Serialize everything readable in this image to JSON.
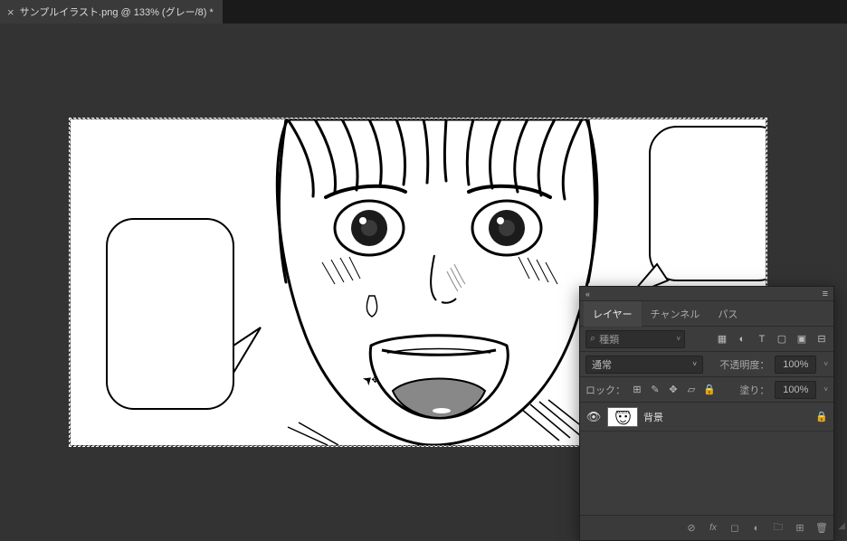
{
  "tab": {
    "close_glyph": "×",
    "title": "サンプルイラスト.png @ 133% (グレー/8) *"
  },
  "cursor": {
    "arrow": "➤",
    "move": "✥"
  },
  "panel": {
    "close_glyph": "«",
    "menu_glyph": "≡",
    "tabs": {
      "layers": "レイヤー",
      "channels": "チャンネル",
      "paths": "パス"
    },
    "filter": {
      "search_glyph": "⌕",
      "label": "種類",
      "chev": "˅",
      "icons": {
        "image": "▦",
        "adjust": "◐",
        "type": "T",
        "shape": "▢",
        "smart": "▣",
        "toggle": "⊟"
      }
    },
    "blend": {
      "mode": "通常",
      "chev": "˅",
      "opacity_label": "不透明度：",
      "opacity_value": "100%",
      "chev2": "˅"
    },
    "lock": {
      "label": "ロック：",
      "icons": {
        "all": "⊞",
        "paint": "✎",
        "move": "✥",
        "artboard": "▱",
        "lock": "🔒"
      },
      "fill_label": "塗り：",
      "fill_value": "100%",
      "chev": "˅"
    },
    "layer0": {
      "eye": "👁",
      "name": "背景",
      "lock_glyph": "🔒"
    },
    "bottom": {
      "link": "⊘",
      "fx": "fx",
      "mask": "◻",
      "adjust": "◐",
      "folder": "🗀",
      "new": "⊞",
      "trash": "🗑"
    }
  }
}
